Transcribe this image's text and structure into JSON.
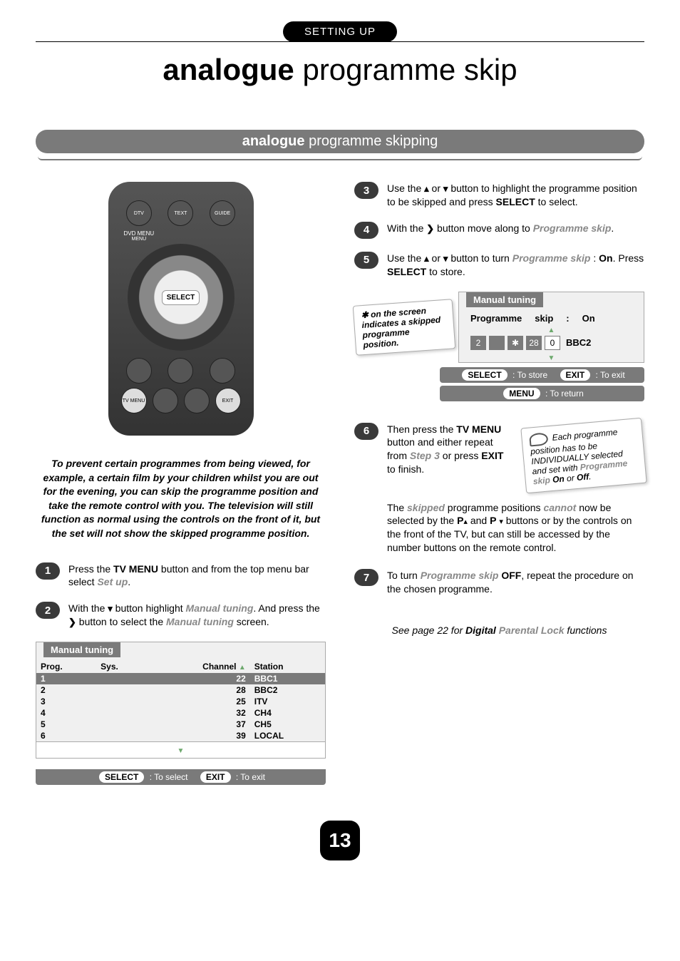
{
  "header": {
    "tab": "SETTING UP"
  },
  "title": {
    "bold": "analogue",
    "rest": " programme skip"
  },
  "section": {
    "bold": "analogue",
    "rest": " programme skipping"
  },
  "remote": {
    "select": "SELECT",
    "btn_dtv": "DTV MENU",
    "btn_text": "TEXT",
    "btn_guide": "GUIDE",
    "btn_dvd": "DVD MENU",
    "btn_tvmenu": "TV MENU",
    "btn_exit": "EXIT"
  },
  "intro": "To prevent certain programmes from being viewed, for example, a certain film by your children whilst you are out for the evening, you can skip the programme position and take the remote control with you. The television will still function as normal using the controls on the front of it, but the set will not show the skipped programme position.",
  "steps": {
    "s1": {
      "n": "1",
      "pre": "Press the ",
      "b1": "TV MENU",
      "mid": " button and from the top menu bar select ",
      "em": "Set up",
      "post": "."
    },
    "s2": {
      "n": "2",
      "pre": "With the ",
      "arrow": "▾",
      "mid": " button highlight ",
      "em1": "Manual tuning",
      "mid2": ". And press the ",
      "arrow2": "❯",
      "mid3": " button to select the ",
      "em2": "Manual tuning",
      "post": " screen."
    },
    "s3": {
      "n": "3",
      "pre": "Use the ",
      "a1": "▴",
      "or": " or ",
      "a2": "▾",
      "mid": " button to highlight the programme position to be skipped and press ",
      "b1": "SELECT",
      "post": " to select."
    },
    "s4": {
      "n": "4",
      "pre": "With the ",
      "arrow": "❯",
      "mid": " button move along to ",
      "em": "Programme skip",
      "post": "."
    },
    "s5": {
      "n": "5",
      "pre": "Use the ",
      "a1": "▴",
      "or": " or ",
      "a2": "▾",
      "mid": " button to turn ",
      "em": "Programme skip",
      "col": " : ",
      "b1": "On",
      "mid2": ". Press ",
      "b2": "SELECT",
      "post": " to store."
    },
    "s6": {
      "n": "6",
      "pre": "Then press the ",
      "b1": "TV MENU",
      "mid": " button and either repeat from ",
      "em": "Step 3",
      "mid2": " or press ",
      "b2": "EXIT",
      "post": " to finish."
    },
    "s7": {
      "n": "7",
      "pre": "To turn ",
      "em": "Programme skip",
      "sp": " ",
      "b1": "OFF",
      "post": ", repeat the procedure on the chosen programme."
    }
  },
  "table1": {
    "title": "Manual tuning",
    "cols": {
      "c1": "Prog.",
      "c2": "Sys.",
      "c3": "Channel",
      "c4": "Station"
    },
    "rows": [
      {
        "prog": "1",
        "sys": "",
        "ch": "22",
        "st": "BBC1",
        "hl": true
      },
      {
        "prog": "2",
        "sys": "",
        "ch": "28",
        "st": "BBC2"
      },
      {
        "prog": "3",
        "sys": "",
        "ch": "25",
        "st": "ITV"
      },
      {
        "prog": "4",
        "sys": "",
        "ch": "32",
        "st": "CH4"
      },
      {
        "prog": "5",
        "sys": "",
        "ch": "37",
        "st": "CH5"
      },
      {
        "prog": "6",
        "sys": "",
        "ch": "39",
        "st": "LOCAL"
      }
    ],
    "legend": {
      "select": "SELECT",
      "selTxt": ": To select",
      "exit": "EXIT",
      "exitTxt": ": To exit"
    }
  },
  "table2": {
    "title": "Manual tuning",
    "row": {
      "label1": "Programme",
      "label2": "skip",
      "col": ":",
      "val": "On"
    },
    "cells": {
      "n1": "2",
      "blank": "",
      "star": "✱",
      "n2": "28",
      "n3": "0",
      "st": "BBC2"
    },
    "callout": "✱ on the screen indicates a skipped programme position.",
    "legend": {
      "select": "SELECT",
      "selTxt": ": To store",
      "exit": "EXIT",
      "exitTxt": ": To exit",
      "menu": "MENU",
      "menuTxt": ": To return"
    }
  },
  "callout_each": {
    "text": "Each programme position has to be INDIVIDUALLY selected and set with ",
    "em": "Programme skip",
    "sp": " ",
    "b": "On",
    "or": " or ",
    "b2": "Off",
    "post": "."
  },
  "para_skipped": {
    "pre": "The ",
    "em1": "skipped",
    "mid": " programme positions ",
    "em2": "cannot",
    "mid2": " now be selected by the ",
    "b1": "P",
    "a1": "▴",
    "and": " and ",
    "b2": "P",
    "a2": "▾",
    "post": " buttons or by the controls on the front of the TV, but can still be accessed by the number buttons on the remote control."
  },
  "see_also": {
    "pre": "See page 22 for ",
    "b": "Digital ",
    "em": "Parental Lock",
    "post": " functions"
  },
  "page_number": "13"
}
